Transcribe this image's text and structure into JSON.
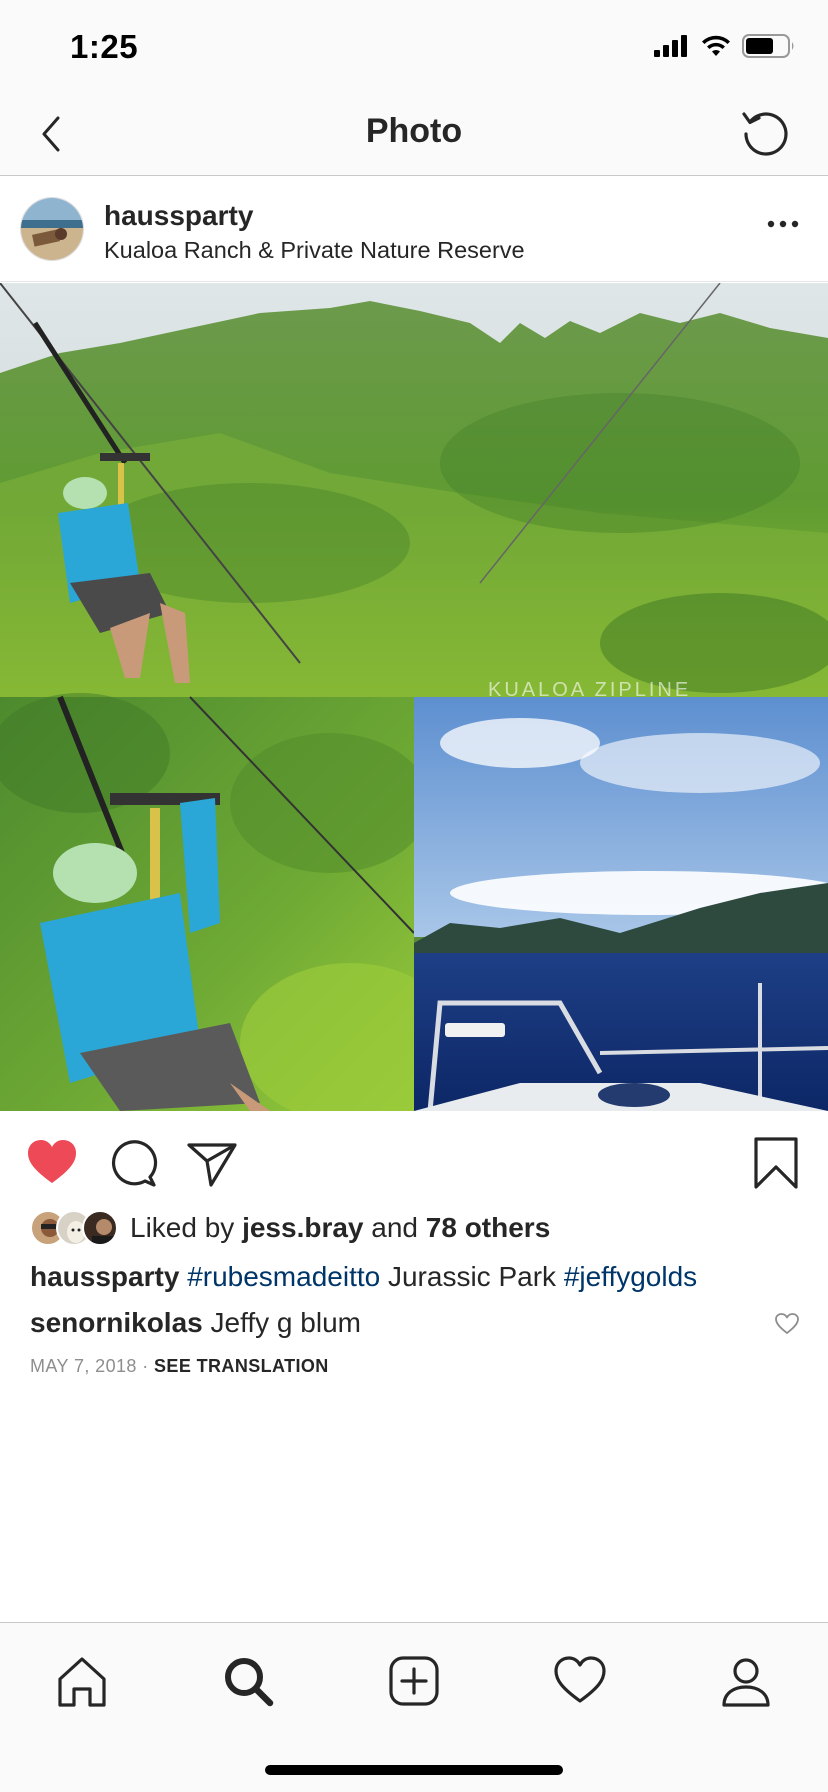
{
  "status_bar": {
    "time": "1:25",
    "icons": [
      "cellular-signal-icon",
      "wifi-icon",
      "battery-icon"
    ]
  },
  "nav": {
    "title": "Photo",
    "back_icon": "chevron-left-icon",
    "refresh_icon": "refresh-icon"
  },
  "post": {
    "username": "haussparty",
    "location": "Kualoa Ranch & Private Nature Reserve",
    "more_icon": "ellipsis-icon",
    "photo_watermark": "KUALOA ZIPLINE",
    "liked": true,
    "likes": {
      "prefix": "Liked by ",
      "user": "jess.bray",
      "and": " and ",
      "others": "78 others"
    },
    "caption": {
      "username": "haussparty",
      "hashtag1": "#rubesmadeitto",
      "text": " Jurassic Park ",
      "hashtag2": "#jeffygolds"
    },
    "comment": {
      "username": "senornikolas",
      "text": "Jeffy g blum"
    },
    "date": "MAY 7, 2018",
    "separator": " · ",
    "see_translation": "SEE TRANSLATION"
  },
  "tabs": [
    "home-icon",
    "search-icon",
    "new-post-icon",
    "activity-heart-icon",
    "profile-icon"
  ],
  "colors": {
    "like_red": "#ed4956",
    "text": "#262626",
    "hashtag": "#003569",
    "muted": "#8e8e8e",
    "bar_bg": "#fafafa"
  }
}
